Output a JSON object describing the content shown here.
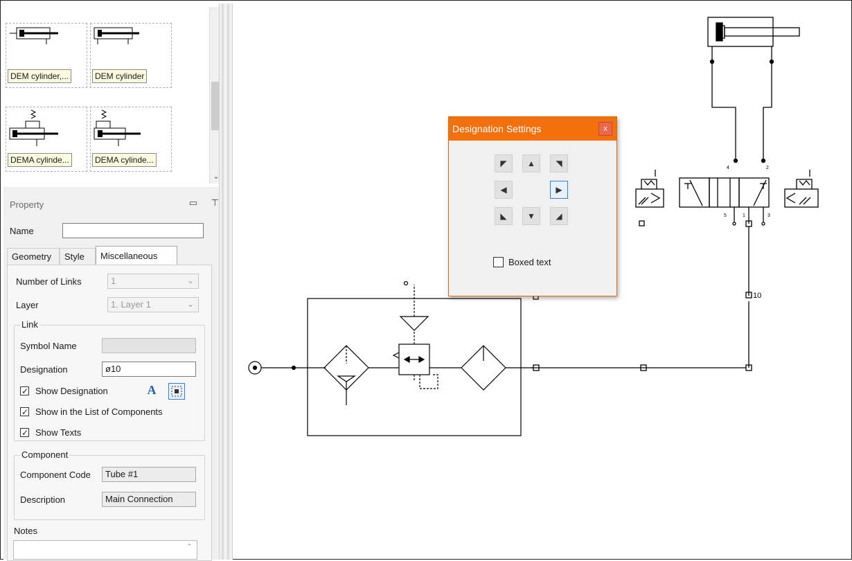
{
  "library": {
    "items": [
      {
        "label": "DEM cylinder,..."
      },
      {
        "label": "DEM cylinder"
      },
      {
        "label": "DEMA cylinde..."
      },
      {
        "label": "DEMA cylinde..."
      }
    ],
    "scroll_down_icon": "chevron-down-icon"
  },
  "property_panel": {
    "title": "Property",
    "name_label": "Name",
    "name_value": "",
    "tabs": [
      {
        "label": "Geometry"
      },
      {
        "label": "Style"
      },
      {
        "label": "Miscellaneous",
        "active": true
      }
    ],
    "misc": {
      "number_of_links_label": "Number of Links",
      "number_of_links_value": "1",
      "layer_label": "Layer",
      "layer_value": "1. Layer 1",
      "link_group": "Link",
      "symbol_name_label": "Symbol Name",
      "symbol_name_value": "",
      "designation_label": "Designation",
      "designation_value": "ø10",
      "show_designation": {
        "label": "Show Designation",
        "checked": true
      },
      "show_in_list": {
        "label": "Show in the List of Components",
        "checked": true
      },
      "show_texts": {
        "label": "Show Texts",
        "checked": true
      },
      "font_icon_text": "A",
      "component_group": "Component",
      "component_code_label": "Component Code",
      "component_code_value": "Tube #1",
      "description_label": "Description",
      "description_value": "Main Connection",
      "notes_label": "Notes"
    }
  },
  "dialog": {
    "title": "Designation Settings",
    "close": "x",
    "buttons": [
      "top-left",
      "top",
      "top-right",
      "left",
      "right",
      "bottom-left",
      "bottom",
      "bottom-right"
    ],
    "selected": "right",
    "boxed_text": {
      "label": "Boxed text",
      "checked": false
    }
  },
  "diagram": {
    "tube_label": "10",
    "port_labels": {
      "p4": "4",
      "p2": "2",
      "p5": "5",
      "p1": "1",
      "p3": "3"
    }
  },
  "colors": {
    "dialog_title": "#f4700d",
    "panel_bg": "#f0f0f0",
    "selected_button_border": "#3a7ec6"
  }
}
